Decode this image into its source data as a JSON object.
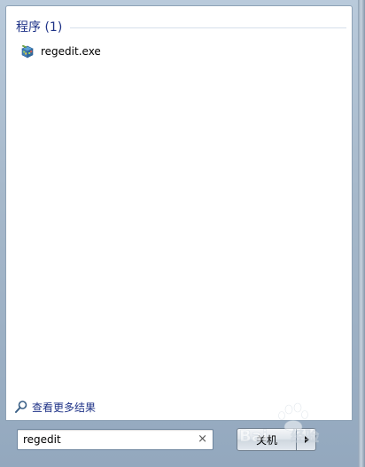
{
  "results": {
    "section_header": "程序 (1)",
    "items": [
      {
        "label": "regedit.exe",
        "icon": "registry-editor-icon"
      }
    ]
  },
  "see_more": {
    "label": "查看更多结果",
    "icon": "search-icon"
  },
  "search": {
    "value": "regedit",
    "clear_icon": "close-icon"
  },
  "power": {
    "shutdown_label": "关机",
    "arrow_icon": "chevron-right-icon"
  },
  "watermark": {
    "text": "Baidu经验"
  }
}
